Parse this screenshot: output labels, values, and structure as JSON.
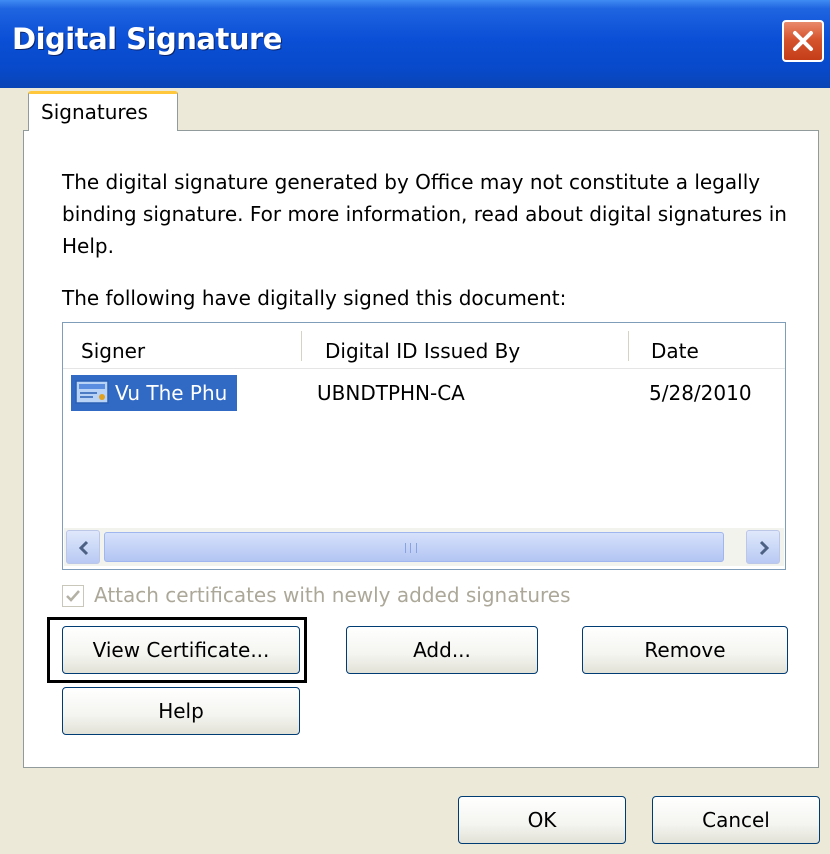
{
  "window": {
    "title": "Digital Signature",
    "close_icon": "close-x-icon"
  },
  "tabs": [
    {
      "label": "Signatures",
      "active": true
    }
  ],
  "info_text": "The digital signature generated by Office may not constitute a legally binding signature. For more information, read about digital signatures in Help.",
  "signed_label": "The following have digitally signed this document:",
  "signature_list": {
    "columns": [
      "Signer",
      "Digital ID Issued By",
      "Date"
    ],
    "rows": [
      {
        "signer": "Vu The Phu",
        "issued_by": "UBNDTPHN-CA",
        "date": "5/28/2010",
        "selected": true,
        "icon": "certificate-icon"
      }
    ]
  },
  "attach_checkbox": {
    "label": "Attach certificates with newly added signatures",
    "checked": true,
    "enabled": false
  },
  "buttons": {
    "view_certificate": "View Certificate...",
    "add": "Add...",
    "remove": "Remove",
    "help": "Help",
    "ok": "OK",
    "cancel": "Cancel"
  },
  "colors": {
    "titlebar": "#0a4fd6",
    "selection": "#316ac5",
    "dialog_face": "#ece9d8",
    "tab_accent": "#ffc83c"
  }
}
